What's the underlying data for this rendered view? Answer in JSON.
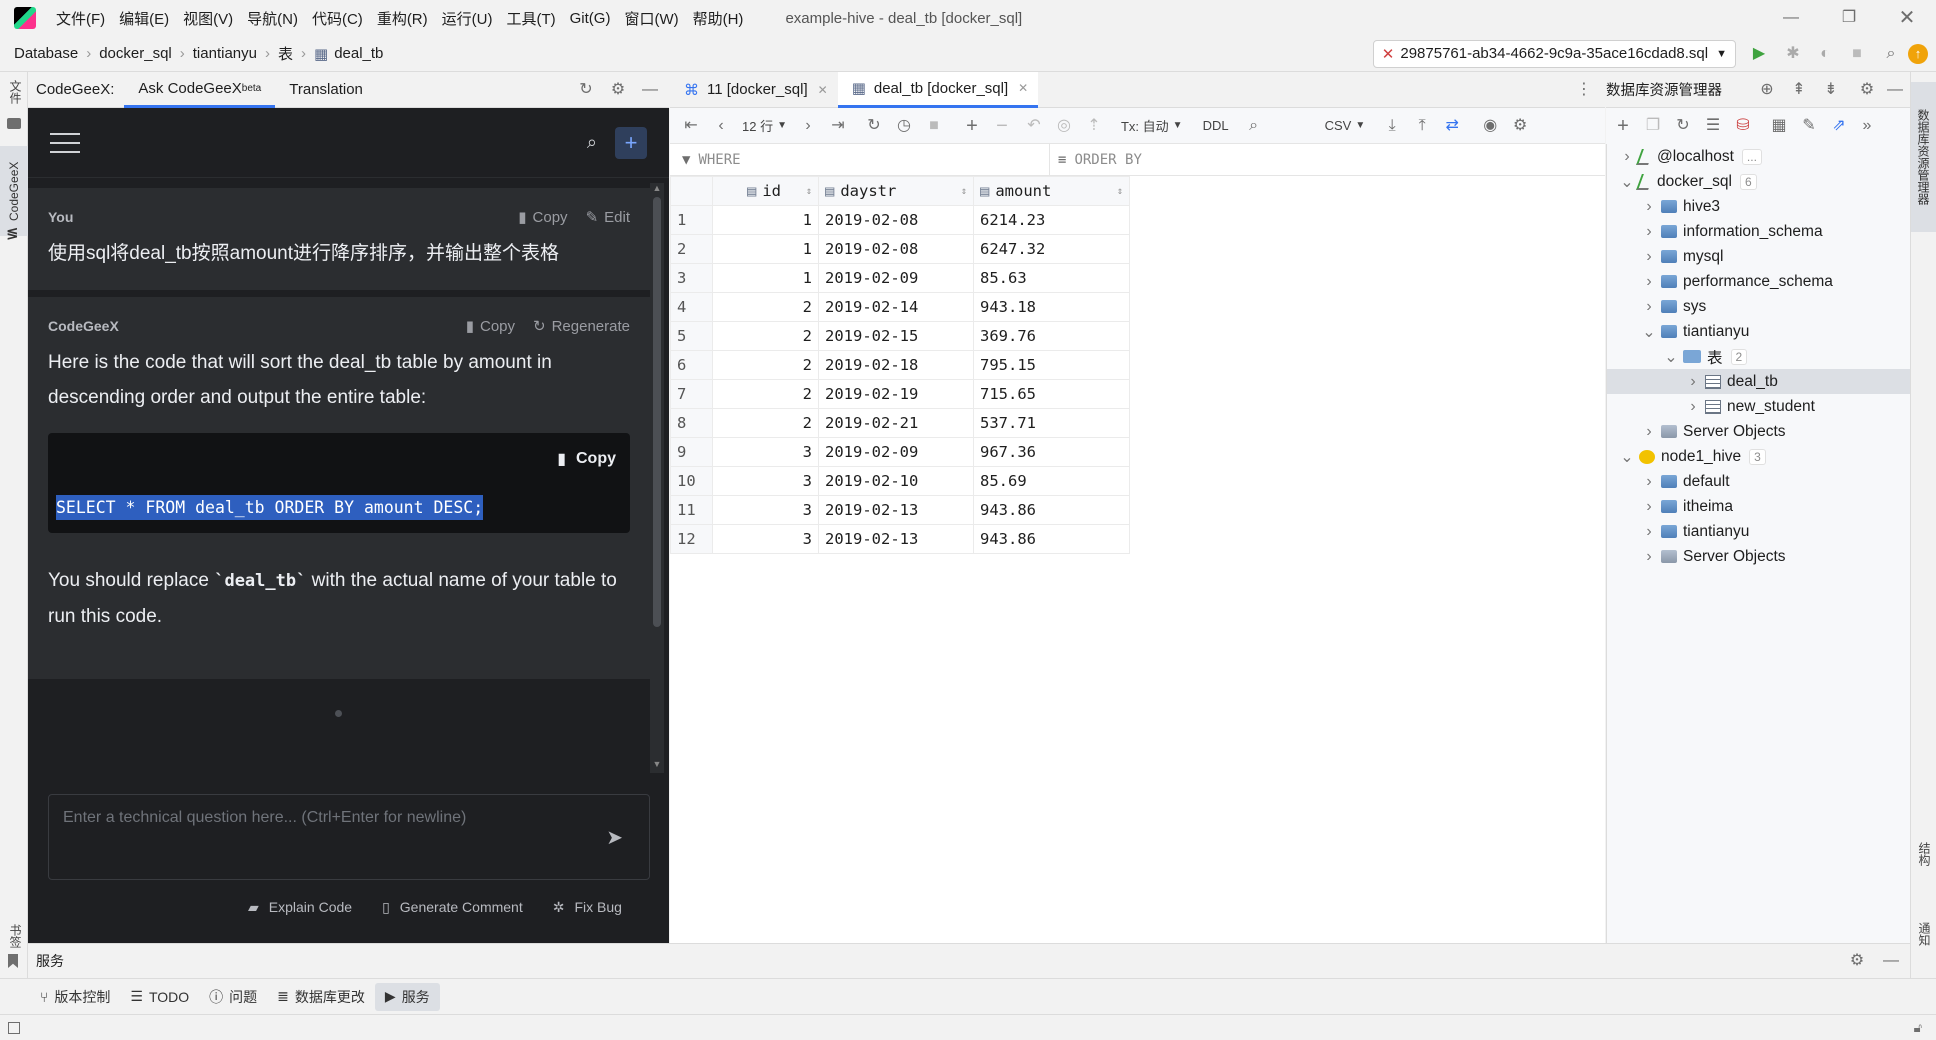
{
  "titlebar": {
    "menus": [
      "文件(F)",
      "编辑(E)",
      "视图(V)",
      "导航(N)",
      "代码(C)",
      "重构(R)",
      "运行(U)",
      "工具(T)",
      "Git(G)",
      "窗口(W)",
      "帮助(H)"
    ],
    "window_title": "example-hive - deal_tb [docker_sql]"
  },
  "breadcrumb": {
    "items": [
      "Database",
      "docker_sql",
      "tiantianyu",
      "表",
      "deal_tb"
    ],
    "run_config": "29875761-ab34-4662-9c9a-35ace16cdad8.sql"
  },
  "left_strip": {
    "top_label": "文件",
    "mid_label": "CodeGeeX",
    "bottom_label": "书签"
  },
  "codegeex": {
    "label": "CodeGeeX:",
    "tabs": [
      "Ask CodeGeeX",
      "Translation"
    ],
    "beta": "beta",
    "user": {
      "name": "You",
      "copy": "Copy",
      "edit": "Edit",
      "text": "使用sql将deal_tb按照amount进行降序排序，并输出整个表格"
    },
    "bot": {
      "name": "CodeGeeX",
      "copy": "Copy",
      "regenerate": "Regenerate",
      "text": "Here is the code that will sort the deal_tb table by amount in descending order and output the entire table:",
      "code_copy": "Copy",
      "code": "SELECT * FROM deal_tb ORDER BY amount DESC;",
      "after_pre": "You should replace ",
      "after_code": "`deal_tb`",
      "after_post": " with the actual name of your table to run this code."
    },
    "input_placeholder": "Enter a technical question here... (Ctrl+Enter for newline)",
    "actions": [
      "Explain Code",
      "Generate Comment",
      "Fix Bug"
    ]
  },
  "editor": {
    "tabs": [
      "11 [docker_sql]",
      "deal_tb [docker_sql]"
    ],
    "rows_label": "12 行",
    "tx_label": "Tx: 自动",
    "ddl_label": "DDL",
    "csv_label": "CSV",
    "where_label": "WHERE",
    "orderby_label": "ORDER BY",
    "columns": [
      "id",
      "daystr",
      "amount"
    ],
    "rows": [
      {
        "n": "1",
        "id": "1",
        "daystr": "2019-02-08",
        "amount": "6214.23"
      },
      {
        "n": "2",
        "id": "1",
        "daystr": "2019-02-08",
        "amount": "6247.32"
      },
      {
        "n": "3",
        "id": "1",
        "daystr": "2019-02-09",
        "amount": "85.63"
      },
      {
        "n": "4",
        "id": "2",
        "daystr": "2019-02-14",
        "amount": "943.18"
      },
      {
        "n": "5",
        "id": "2",
        "daystr": "2019-02-15",
        "amount": "369.76"
      },
      {
        "n": "6",
        "id": "2",
        "daystr": "2019-02-18",
        "amount": "795.15"
      },
      {
        "n": "7",
        "id": "2",
        "daystr": "2019-02-19",
        "amount": "715.65"
      },
      {
        "n": "8",
        "id": "2",
        "daystr": "2019-02-21",
        "amount": "537.71"
      },
      {
        "n": "9",
        "id": "3",
        "daystr": "2019-02-09",
        "amount": "967.36"
      },
      {
        "n": "10",
        "id": "3",
        "daystr": "2019-02-10",
        "amount": "85.69"
      },
      {
        "n": "11",
        "id": "3",
        "daystr": "2019-02-13",
        "amount": "943.86"
      },
      {
        "n": "12",
        "id": "3",
        "daystr": "2019-02-13",
        "amount": "943.86"
      }
    ]
  },
  "db_panel": {
    "title": "数据库资源管理器",
    "tree": [
      {
        "label": "@localhost",
        "badge": "...",
        "level": 0,
        "expanded": false,
        "icon": "datasource-icon"
      },
      {
        "label": "docker_sql",
        "badge": "6",
        "level": 0,
        "expanded": true,
        "icon": "datasource-icon"
      },
      {
        "label": "hive3",
        "level": 1,
        "expanded": false,
        "icon": "schema-icon"
      },
      {
        "label": "information_schema",
        "level": 1,
        "expanded": false,
        "icon": "schema-icon"
      },
      {
        "label": "mysql",
        "level": 1,
        "expanded": false,
        "icon": "schema-icon"
      },
      {
        "label": "performance_schema",
        "level": 1,
        "expanded": false,
        "icon": "schema-icon"
      },
      {
        "label": "sys",
        "level": 1,
        "expanded": false,
        "icon": "schema-icon"
      },
      {
        "label": "tiantianyu",
        "level": 1,
        "expanded": true,
        "icon": "schema-icon"
      },
      {
        "label": "表",
        "badge": "2",
        "level": 2,
        "expanded": true,
        "icon": "folder-icon"
      },
      {
        "label": "deal_tb",
        "level": 3,
        "expanded": false,
        "icon": "table-icon",
        "selected": true
      },
      {
        "label": "new_student",
        "level": 3,
        "expanded": false,
        "icon": "table-icon"
      },
      {
        "label": "Server Objects",
        "level": 1,
        "expanded": false,
        "icon": "server-objects-icon"
      },
      {
        "label": "node1_hive",
        "badge": "3",
        "level": 0,
        "expanded": true,
        "icon": "hive-icon"
      },
      {
        "label": "default",
        "level": 1,
        "expanded": false,
        "icon": "schema-icon"
      },
      {
        "label": "itheima",
        "level": 1,
        "expanded": false,
        "icon": "schema-icon"
      },
      {
        "label": "tiantianyu",
        "level": 1,
        "expanded": false,
        "icon": "schema-icon"
      },
      {
        "label": "Server Objects",
        "level": 1,
        "expanded": false,
        "icon": "server-objects-icon"
      }
    ]
  },
  "right_strip": {
    "top_label": "数据库资源管理器",
    "mid_label": "结构",
    "bottom_label": "通知"
  },
  "services_label": "服务",
  "bottom_tabs": [
    "版本控制",
    "TODO",
    "问题",
    "数据库更改",
    "服务"
  ]
}
